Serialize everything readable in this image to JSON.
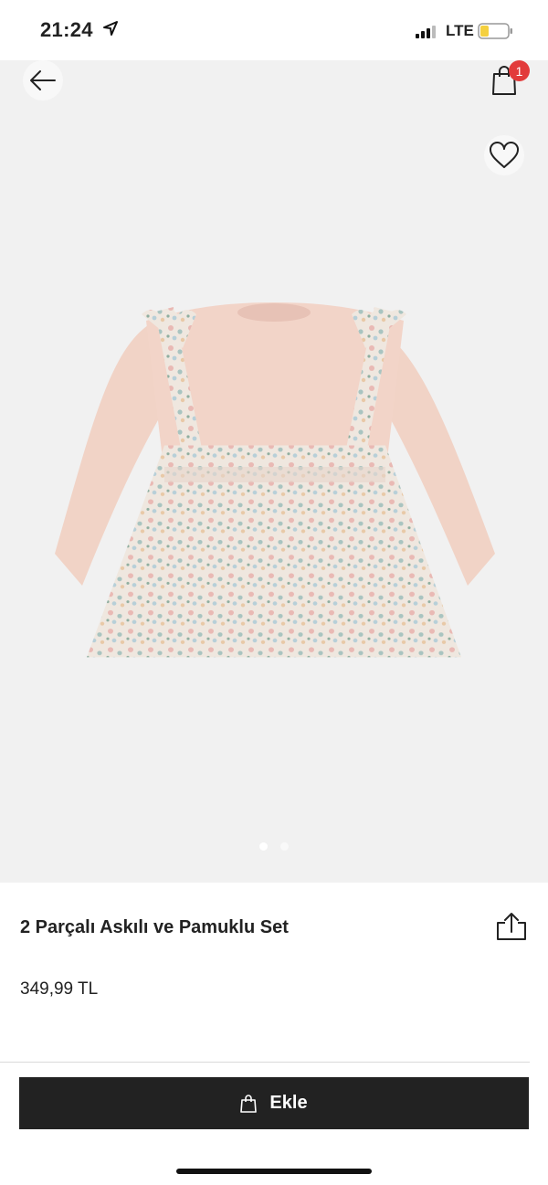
{
  "status": {
    "time": "21:24",
    "network": "LTE"
  },
  "header": {
    "cart_count": "1"
  },
  "gallery": {
    "page_count": 2,
    "active_page": 1
  },
  "product": {
    "title": "2 Parçalı Askılı ve Pamuklu Set",
    "price": "349,99 TL"
  },
  "actions": {
    "add_label": "Ekle"
  },
  "icons": [
    "location-arrow-icon",
    "signal-icon",
    "battery-icon",
    "back-arrow-icon",
    "shopping-bag-icon",
    "heart-icon",
    "share-icon",
    "bag-icon"
  ],
  "colors": {
    "primary_button": "#222222",
    "badge": "#e23b3b",
    "gallery_bg": "#f1f1f1",
    "battery": "#f4d03f"
  }
}
